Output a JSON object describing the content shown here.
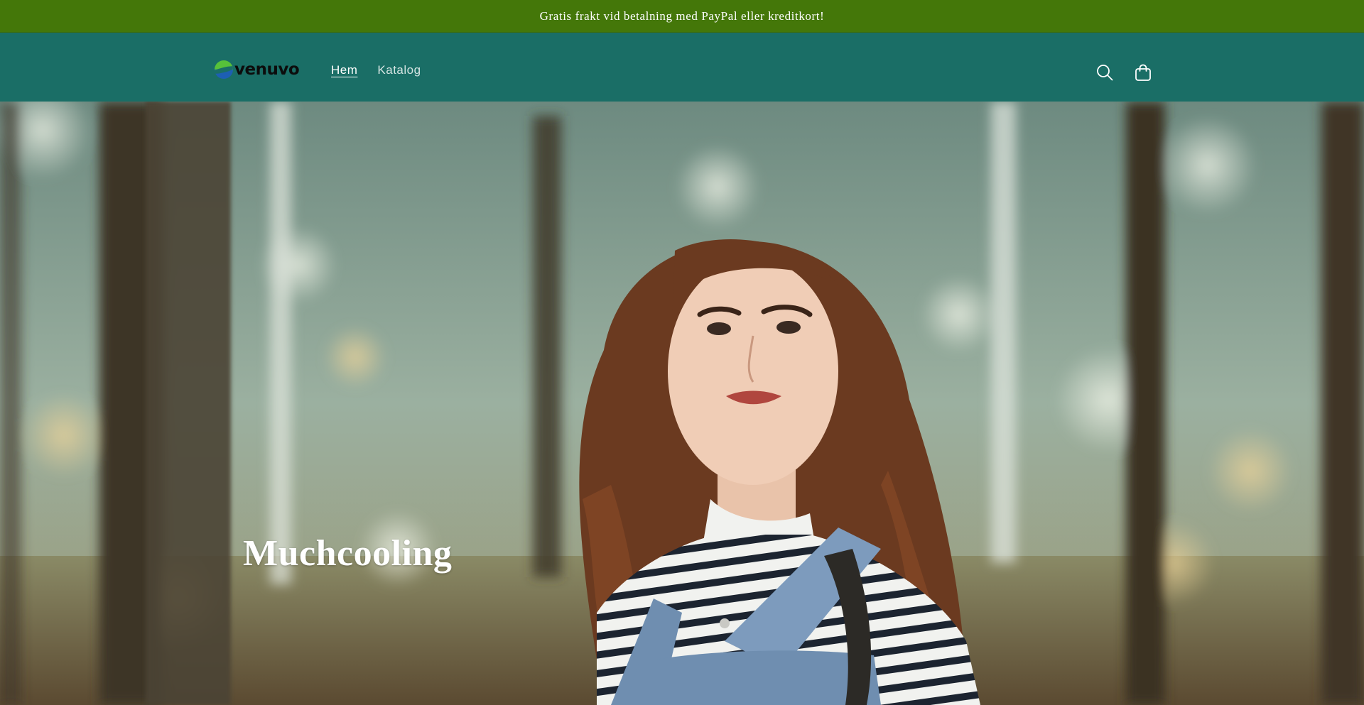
{
  "announcement": {
    "icon": "truck-icon",
    "text": "Gratis frakt vid betalning med PayPal eller kreditkort!"
  },
  "header": {
    "logo_text": "venuvo",
    "nav": [
      {
        "label": "Hem",
        "active": true
      },
      {
        "label": "Katalog",
        "active": false
      }
    ],
    "icons": [
      "search-icon",
      "cart-icon"
    ]
  },
  "hero": {
    "title": "Muchcooling",
    "image": "woman-with-curly-hair-in-striped-shirt-and-denim-overalls-among-trees"
  },
  "colors": {
    "announcement_bg": "#447709",
    "header_bg": "#1a6e66",
    "text": "#ffffff"
  }
}
